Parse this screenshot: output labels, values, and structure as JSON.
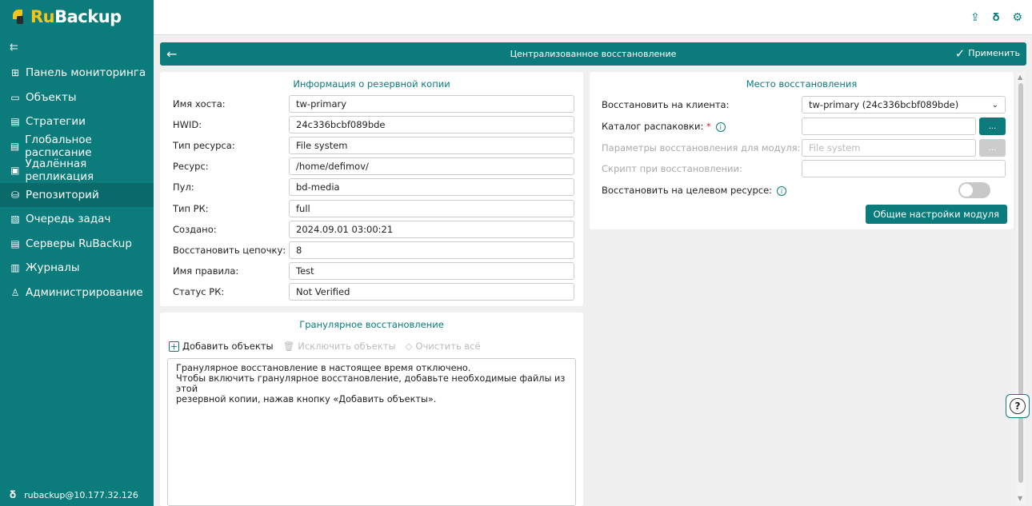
{
  "brand": {
    "ru": "Ru",
    "backup": "Backup"
  },
  "sidebar": {
    "collapse": "⇇",
    "items": [
      {
        "label": "Панель мониторинга",
        "icon": "dashboard-icon"
      },
      {
        "label": "Объекты",
        "icon": "monitor-icon"
      },
      {
        "label": "Стратегии",
        "icon": "strategy-icon"
      },
      {
        "label": "Глобальное расписание",
        "icon": "schedule-icon"
      },
      {
        "label": "Удалённая репликация",
        "icon": "replication-icon"
      },
      {
        "label": "Репозиторий",
        "icon": "repository-icon"
      },
      {
        "label": "Очередь задач",
        "icon": "queue-icon"
      },
      {
        "label": "Серверы RuBackup",
        "icon": "servers-icon"
      },
      {
        "label": "Журналы",
        "icon": "logs-icon"
      },
      {
        "label": "Администрирование",
        "icon": "admin-icon"
      }
    ],
    "active_index": 5,
    "user": "rubackup@10.177.32.126"
  },
  "titlebar": {
    "title": "Централизованное восстановление",
    "apply": "Применить"
  },
  "info": {
    "title": "Информация о резервной копии",
    "rows": [
      {
        "label": "Имя хоста:",
        "value": "tw-primary"
      },
      {
        "label": "HWID:",
        "value": "24c336bcbf089bde"
      },
      {
        "label": "Тип ресурса:",
        "value": "File system"
      },
      {
        "label": "Ресурс:",
        "value": "/home/defimov/"
      },
      {
        "label": "Пул:",
        "value": "bd-media"
      },
      {
        "label": "Тип РК:",
        "value": "full"
      },
      {
        "label": "Создано:",
        "value": "2024.09.01 03:00:21"
      },
      {
        "label": "Восстановить цепочку:",
        "value": "8"
      },
      {
        "label": "Имя правила:",
        "value": "Test"
      },
      {
        "label": "Статус РК:",
        "value": "Not Verified"
      }
    ]
  },
  "dest": {
    "title": "Место восстановления",
    "restore_client_label": "Восстановить на клиента:",
    "restore_client_value": "tw-primary (24c336bcbf089bde)",
    "unpack_dir_label": "Каталог распаковки:",
    "unpack_dir_required": "*",
    "unpack_dir_value": "",
    "module_params_label": "Параметры восстановления для модуля:",
    "module_params_placeholder": "File system",
    "script_label": "Скрипт при восстановлении:",
    "script_value": "",
    "restore_target_label": "Восстановить на целевом ресурсе:",
    "restore_target_on": false,
    "dots": "...",
    "general_settings": "Общие настройки модуля"
  },
  "granular": {
    "title": "Гранулярное восстановление",
    "add": "Добавить объекты",
    "exclude": "Исключить объекты",
    "clear": "Очистить всё",
    "message_line1": "Гранулярное восстановление в настоящее время отключено.",
    "message_line2": "Чтобы включить гранулярное восстановление, добавьте необходимые файлы из этой",
    "message_line3": "резервной копии, нажав кнопку «Добавить объекты»."
  },
  "help": "?"
}
